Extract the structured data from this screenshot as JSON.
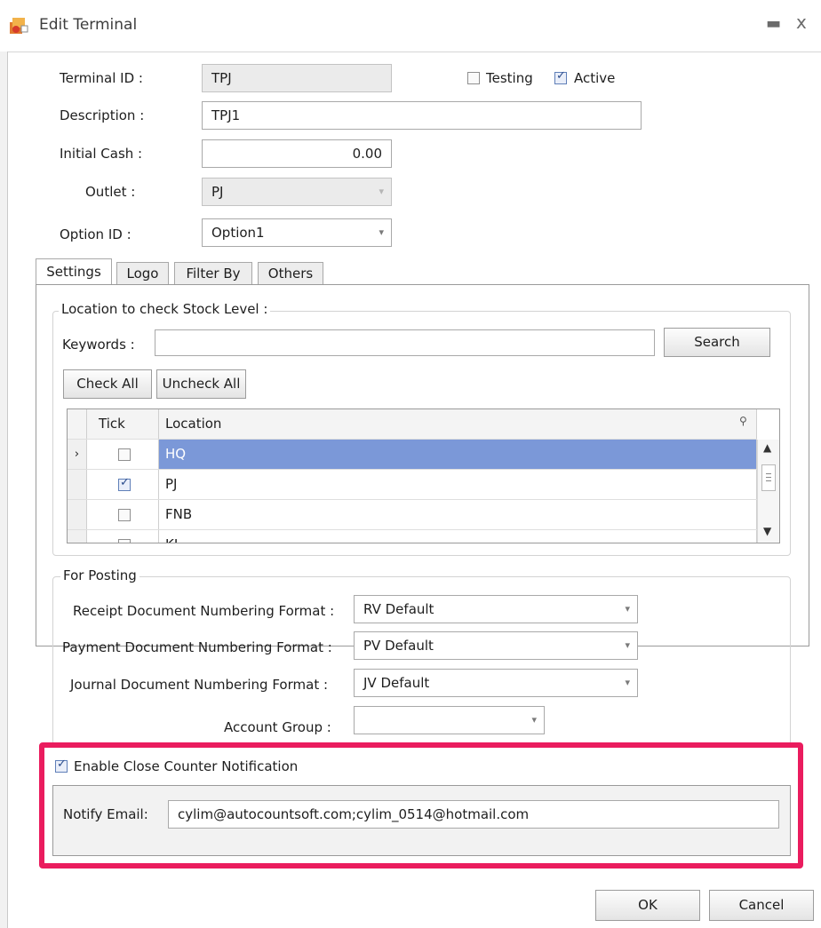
{
  "window": {
    "title": "Edit Terminal",
    "minimize_glyph": "▬",
    "close_glyph": "x"
  },
  "form": {
    "terminal_id_label": "Terminal ID :",
    "terminal_id_value": "TPJ",
    "testing_label": "Testing",
    "testing_checked": false,
    "active_label": "Active",
    "active_checked": true,
    "description_label": "Description :",
    "description_value": "TPJ1",
    "initial_cash_label": "Initial Cash :",
    "initial_cash_value": "0.00",
    "outlet_label": "Outlet :",
    "outlet_value": "PJ",
    "option_id_label": "Option ID :",
    "option_id_value": "Option1"
  },
  "tabs": [
    "Settings",
    "Logo",
    "Filter By",
    "Others"
  ],
  "stock": {
    "group_title": "Location to check Stock Level :",
    "keywords_label": "Keywords :",
    "keywords_value": "",
    "search_button": "Search",
    "check_all_button": "Check All",
    "uncheck_all_button": "Uncheck All",
    "grid": {
      "columns": [
        "Tick",
        "Location"
      ],
      "rows": [
        {
          "location": "HQ",
          "checked": false,
          "selected": true
        },
        {
          "location": "PJ",
          "checked": true,
          "selected": false
        },
        {
          "location": "FNB",
          "checked": false,
          "selected": false
        },
        {
          "location": "KL",
          "checked": false,
          "selected": false
        }
      ]
    }
  },
  "posting": {
    "group_title": "For Posting",
    "receipt_label": "Receipt Document Numbering Format :",
    "receipt_value": "RV Default",
    "payment_label": "Payment Document Numbering Format :",
    "payment_value": "PV Default",
    "journal_label": "Journal Document Numbering Format :",
    "journal_value": "JV Default",
    "account_group_label": "Account Group :",
    "account_group_value": ""
  },
  "notification": {
    "enable_label": "Enable Close Counter Notification",
    "enable_checked": true,
    "notify_email_label": "Notify Email:",
    "notify_email_value": "cylim@autocountsoft.com;cylim_0514@hotmail.com"
  },
  "buttons": {
    "ok": "OK",
    "cancel": "Cancel"
  },
  "colors": {
    "highlight_border": "#ea1c5e",
    "selected_row": "#7b98d8"
  }
}
